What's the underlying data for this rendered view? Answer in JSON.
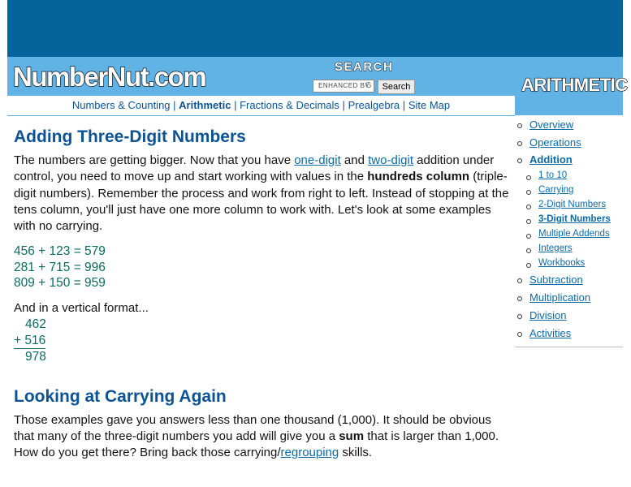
{
  "header": {
    "logo": "NumberNut.com",
    "search_title": "SEARCH",
    "search_placeholder": "ENHANCED BY",
    "search_g": "G",
    "search_button": "Search",
    "section_title": "ARITHMETIC"
  },
  "nav": {
    "items": [
      "Numbers & Counting",
      "Arithmetic",
      "Fractions & Decimals",
      "Prealgebra",
      "Site Map"
    ],
    "separator": "|"
  },
  "article": {
    "title1": "Adding Three-Digit Numbers",
    "p1_a": "The numbers are getting bigger. Now that you have ",
    "p1_link1": "one-digit",
    "p1_b": " and ",
    "p1_link2": "two-digit",
    "p1_c": " addition under control, you need to move up and start working with values in the ",
    "p1_bold": "hundreds column",
    "p1_d": " (triple-digit numbers). Remember the process and work from right to left. Instead of stopping at the tens column, you'll just have one more column to work with. Let's look at some examples with no carrying.",
    "examples": [
      "456 + 123 = 579",
      "281 + 715 = 996",
      "809 + 150 = 959"
    ],
    "vertical_intro": "And in a vertical format...",
    "vertical": [
      "462",
      "+ 516",
      "978"
    ],
    "title2": "Looking at Carrying Again",
    "p2_a": "Those examples gave you answers less than one thousand (1,000). It should be obvious that many of the three-digit numbers you add will give you a ",
    "p2_bold": "sum",
    "p2_b": " that is larger than 1,000. How do you get there? Bring back those carrying/",
    "p2_link": "regrouping",
    "p2_c": " skills."
  },
  "sidebar": {
    "items": [
      "Overview",
      "Operations",
      "Addition"
    ],
    "sub_items": [
      "1 to 10",
      "Carrying",
      "2-Digit Numbers",
      "3-Digit Numbers",
      "Multiple Addends",
      "Integers",
      "Workbooks"
    ],
    "items_after": [
      "Subtraction",
      "Multiplication",
      "Division",
      "Activities"
    ]
  }
}
